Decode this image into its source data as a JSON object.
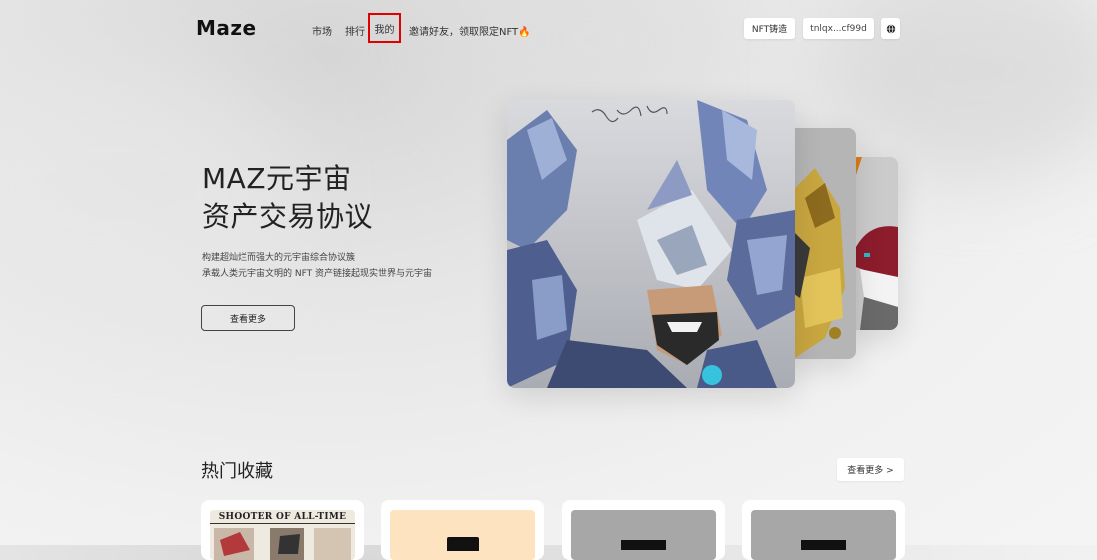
{
  "header": {
    "logo": "Maze",
    "nav": [
      "市场",
      "排行",
      "我的"
    ],
    "invite": "邀请好友，领取限定NFT",
    "nft_button": "NFT铸造",
    "wallet": "tnlqx...cf99d"
  },
  "hero": {
    "title_line1": "MAZ元宇宙",
    "title_line2": "资产交易协议",
    "subtitle_line1": "构建超灿烂而强大的元宇宙综合协议簇",
    "subtitle_line2": "承载人类元宇宙文明的 NFT 资产链接起现实世界与元宇宙",
    "button": "查看更多"
  },
  "hot": {
    "title": "热门收藏",
    "more": "查看更多 >",
    "items": [
      {
        "image_text": "SHOOTER OF ALL-TIME"
      },
      {
        "image_text": ""
      },
      {
        "image_text": ""
      },
      {
        "image_text": ""
      }
    ]
  },
  "colors": {
    "highlight_border": "#e00000",
    "fire": "#f28a00"
  }
}
